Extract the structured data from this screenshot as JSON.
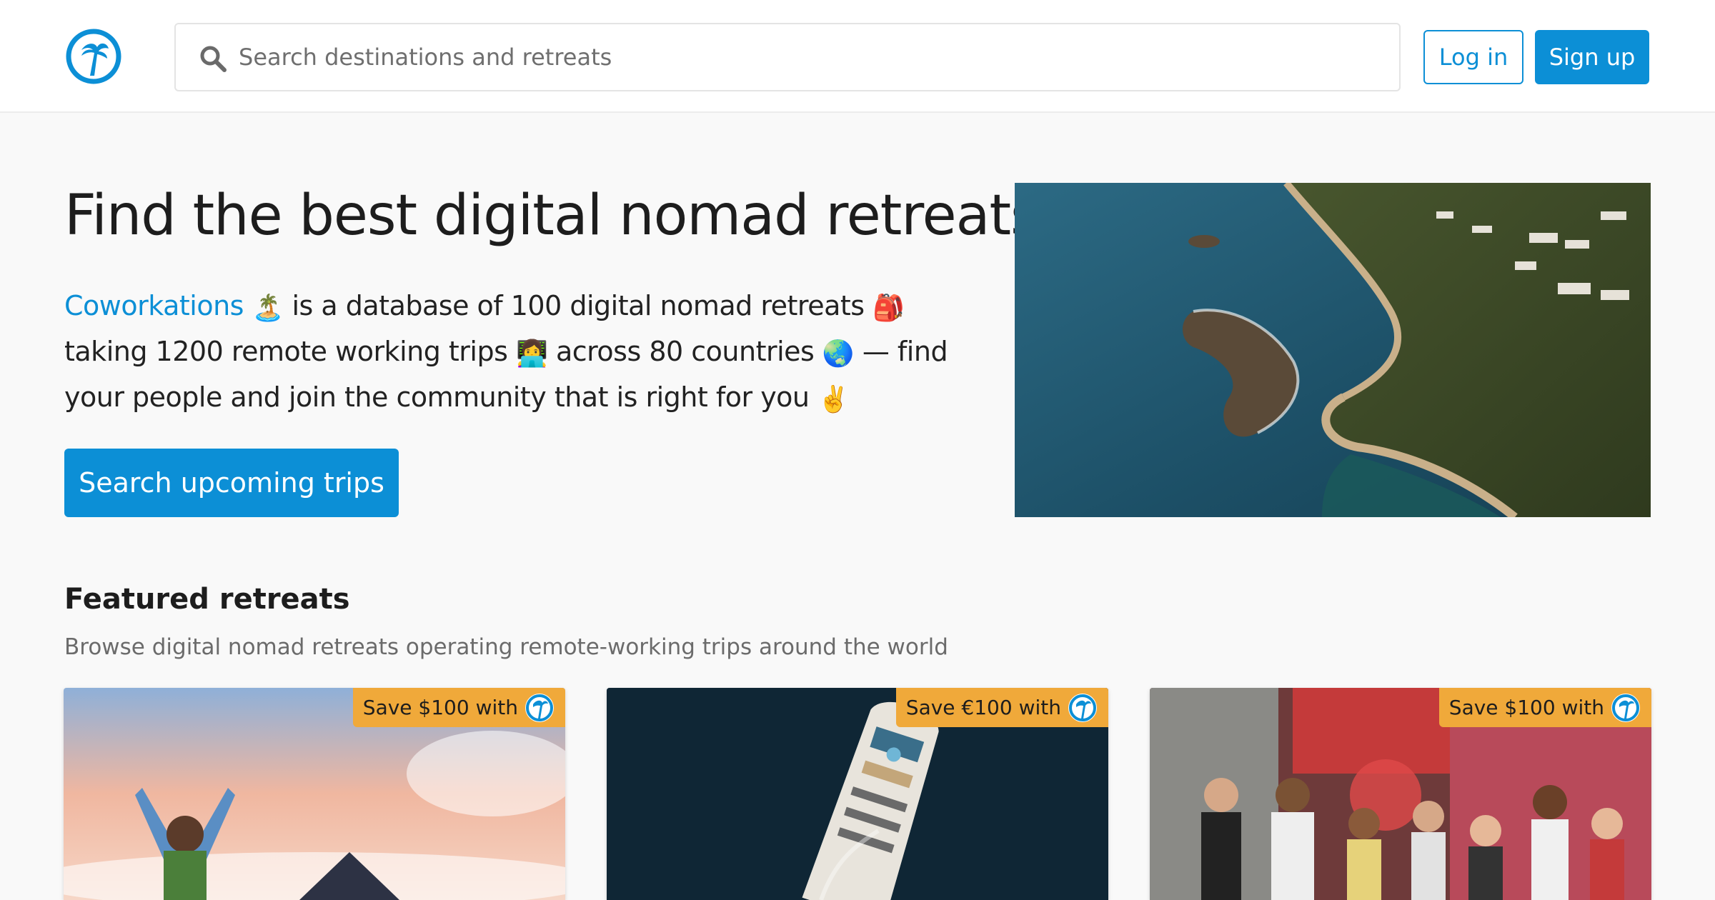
{
  "header": {
    "search_placeholder": "Search destinations and retreats",
    "login_label": "Log in",
    "signup_label": "Sign up",
    "logo_icon": "palm-tree-logo-icon"
  },
  "hero": {
    "title": "Find the best digital nomad retreats",
    "brand": "Coworkations",
    "desc_1": "is a database of 100 digital nomad retreats",
    "desc_2": "taking 1200 remote working trips",
    "desc_3": "across 80 countries",
    "desc_4": "— find your people and join the community that is right for you",
    "emoji_island": "🏝️",
    "emoji_backpack": "🎒",
    "emoji_laptop": "👩‍💻",
    "emoji_globe": "🌏",
    "emoji_peace": "✌️",
    "cta_label": "Search upcoming trips"
  },
  "featured": {
    "title": "Featured retreats",
    "subtitle": "Browse digital nomad retreats operating remote-working trips around the world",
    "cards": [
      {
        "badge": "Save $100 with"
      },
      {
        "badge": "Save €100 with"
      },
      {
        "badge": "Save $100 with"
      }
    ]
  },
  "colors": {
    "accent": "#0c8fd6",
    "badge": "#f0a93a",
    "background": "#f9f9f9"
  }
}
